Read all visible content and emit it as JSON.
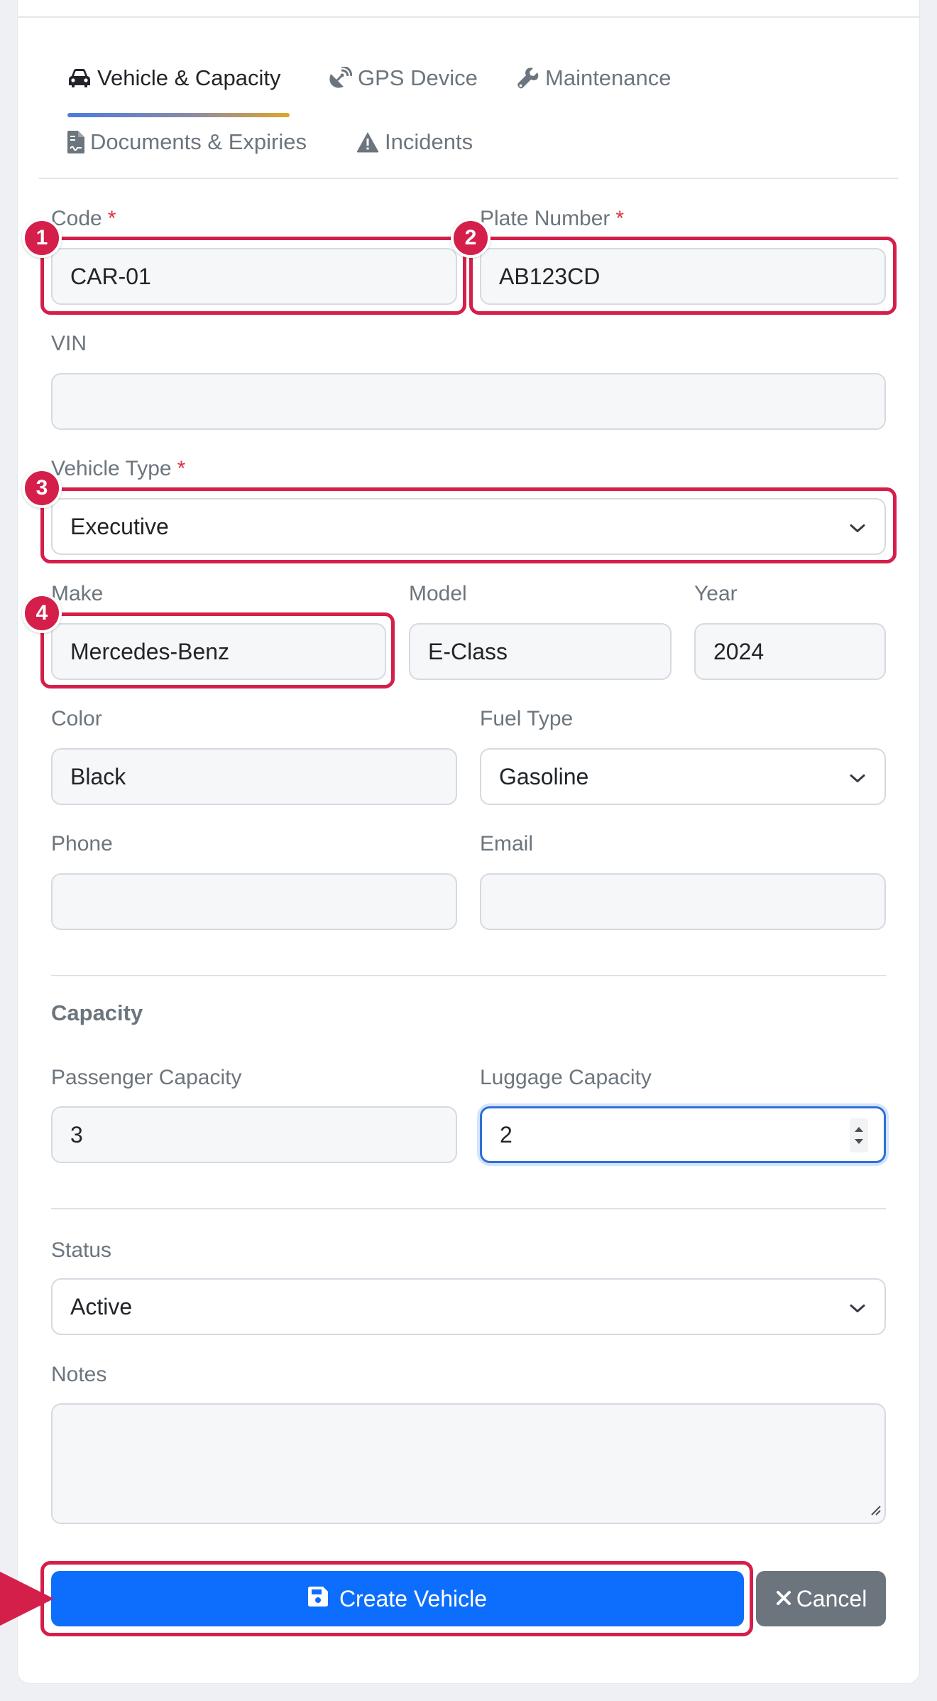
{
  "tabs": [
    {
      "label": "Vehicle & Capacity",
      "icon": "car-icon",
      "active": true
    },
    {
      "label": "GPS Device",
      "icon": "satellite-dish-icon",
      "active": false
    },
    {
      "label": "Maintenance",
      "icon": "wrench-icon",
      "active": false
    },
    {
      "label": "Documents & Expiries",
      "icon": "file-contract-icon",
      "active": false
    },
    {
      "label": "Incidents",
      "icon": "warning-triangle-icon",
      "active": false
    }
  ],
  "required_mark": "*",
  "form": {
    "code": {
      "label": "Code",
      "value": "CAR-01"
    },
    "plate": {
      "label": "Plate Number",
      "value": "AB123CD"
    },
    "vin": {
      "label": "VIN",
      "value": ""
    },
    "vehicle_type": {
      "label": "Vehicle Type",
      "value": "Executive"
    },
    "make": {
      "label": "Make",
      "value": "Mercedes-Benz"
    },
    "model": {
      "label": "Model",
      "value": "E-Class"
    },
    "year": {
      "label": "Year",
      "value": "2024"
    },
    "color": {
      "label": "Color",
      "value": "Black"
    },
    "fuel_type": {
      "label": "Fuel Type",
      "value": "Gasoline"
    },
    "phone": {
      "label": "Phone",
      "value": ""
    },
    "email": {
      "label": "Email",
      "value": ""
    },
    "capacity_section": "Capacity",
    "passenger_capacity": {
      "label": "Passenger Capacity",
      "value": "3"
    },
    "luggage_capacity": {
      "label": "Luggage Capacity",
      "value": "2"
    },
    "status": {
      "label": "Status",
      "value": "Active"
    },
    "notes": {
      "label": "Notes",
      "value": ""
    }
  },
  "buttons": {
    "create": {
      "label": "Create Vehicle",
      "icon": "floppy-disk-icon"
    },
    "cancel": {
      "label": "Cancel",
      "icon": "close-icon"
    }
  },
  "annotations": {
    "markers": [
      "1",
      "2",
      "3",
      "4"
    ],
    "color": "#d41f4a"
  },
  "colors": {
    "primary": "#0d6efd",
    "secondary": "#6c757d",
    "required": "#dc3545"
  }
}
